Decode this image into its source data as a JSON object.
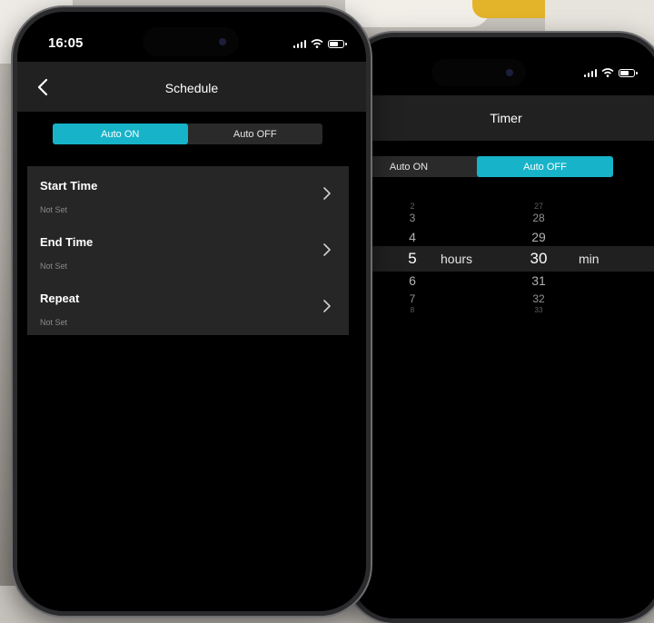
{
  "front": {
    "status": {
      "time": "16:05"
    },
    "header": {
      "title": "Schedule"
    },
    "tabs": [
      {
        "label": "Auto ON",
        "active": true
      },
      {
        "label": "Auto OFF",
        "active": false
      }
    ],
    "items": [
      {
        "title": "Start Time",
        "value": "Not Set"
      },
      {
        "title": "End Time",
        "value": "Not Set"
      },
      {
        "title": "Repeat",
        "value": "Not Set"
      }
    ]
  },
  "back": {
    "header": {
      "title": "Timer"
    },
    "tabs": [
      {
        "label": "Auto ON",
        "active": false
      },
      {
        "label": "Auto OFF",
        "active": true
      }
    ],
    "hours_picker": {
      "values": [
        "2",
        "3",
        "4",
        "5",
        "6",
        "7",
        "8"
      ],
      "selected": "5",
      "unit": "hours"
    },
    "minutes_picker": {
      "values": [
        "27",
        "28",
        "29",
        "30",
        "31",
        "32",
        "33"
      ],
      "selected": "30",
      "unit": "min"
    }
  },
  "colors": {
    "accent": "#17b3c9",
    "panel": "#262626",
    "header": "#212121",
    "screen": "#000000"
  }
}
